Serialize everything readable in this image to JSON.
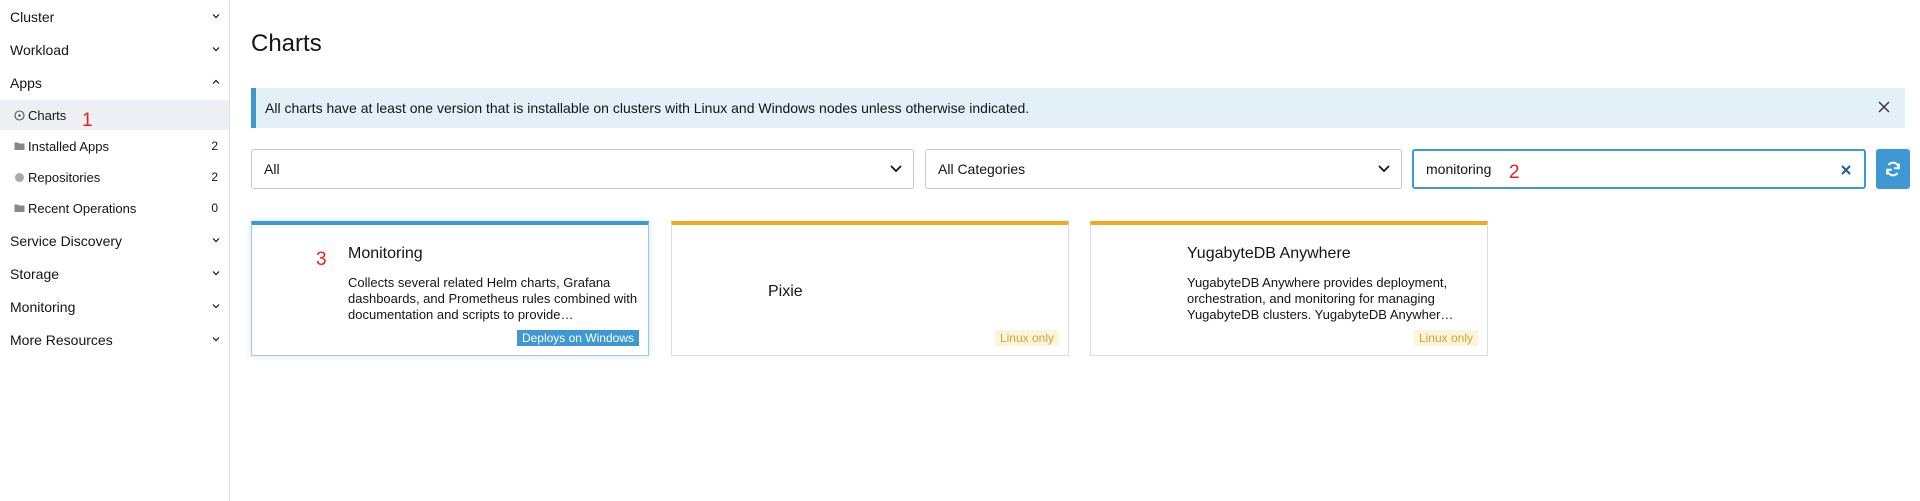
{
  "sidebar": {
    "groups": [
      {
        "label": "Cluster"
      },
      {
        "label": "Workload"
      },
      {
        "label": "Apps"
      },
      {
        "label": "Service Discovery"
      },
      {
        "label": "Storage"
      },
      {
        "label": "Monitoring"
      },
      {
        "label": "More Resources"
      }
    ],
    "apps_items": [
      {
        "label": "Charts",
        "icon": "compass-icon",
        "count": ""
      },
      {
        "label": "Installed Apps",
        "icon": "folder-icon",
        "count": "2"
      },
      {
        "label": "Repositories",
        "icon": "circle-icon",
        "count": "2"
      },
      {
        "label": "Recent Operations",
        "icon": "folder-icon",
        "count": "0"
      }
    ]
  },
  "annotations": {
    "one": "1",
    "two": "2",
    "three": "3"
  },
  "main": {
    "title": "Charts",
    "banner": "All charts have at least one version that is installable on clusters with Linux and Windows nodes unless otherwise indicated.",
    "filters": {
      "repo_select": "All",
      "category_select": "All Categories",
      "search_value": "monitoring"
    }
  },
  "cards": [
    {
      "title": "Monitoring",
      "description": "Collects several related Helm charts, Grafana dashboards, and Prometheus rules combined with documentation and scripts to provide…",
      "badge": "Deploys on Windows"
    },
    {
      "title": "Pixie",
      "description": "",
      "badge": "Linux only"
    },
    {
      "title": "YugabyteDB Anywhere",
      "description": "YugabyteDB Anywhere provides deployment, orchestration, and monitoring for managing YugabyteDB clusters. YugabyteDB Anywher…",
      "badge": "Linux only"
    }
  ],
  "colors": {
    "accent": "#3d98d3",
    "card_border_linux": "#f5a623",
    "banner_bg": "#e3f0f7",
    "annotation": "#e8231c"
  }
}
